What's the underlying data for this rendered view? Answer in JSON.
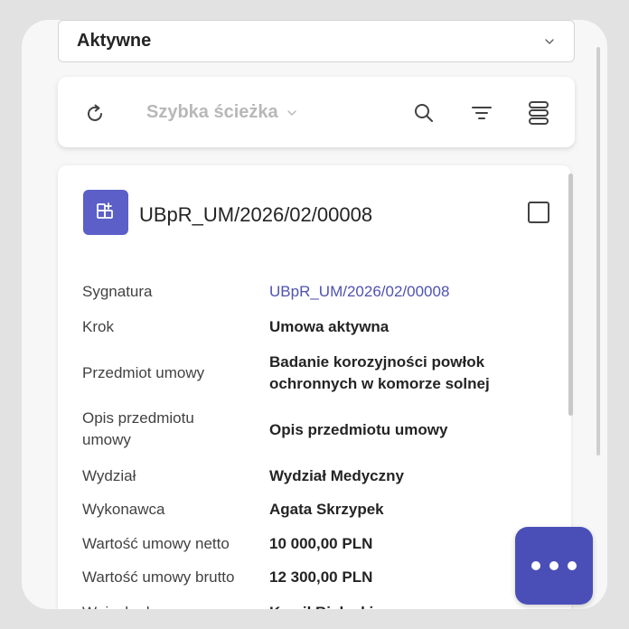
{
  "status_filter": {
    "value": "Aktywne"
  },
  "toolbar": {
    "quick_path_label": "Szybka ścieżka"
  },
  "card": {
    "title": "UBpR_UM/2026/02/00008",
    "fields": [
      {
        "label": "Sygnatura",
        "value": "UBpR_UM/2026/02/00008"
      },
      {
        "label": "Krok",
        "value": "Umowa aktywna"
      },
      {
        "label": "Przedmiot umowy",
        "value": "Badanie korozyjności powłok ochronnych w komorze solnej"
      },
      {
        "label": "Opis przedmiotu umowy",
        "value": "Opis przedmiotu umowy"
      },
      {
        "label": "Wydział",
        "value": "Wydział Medyczny"
      },
      {
        "label": "Wykonawca",
        "value": "Agata Skrzypek"
      },
      {
        "label": "Wartość umowy netto",
        "value": "10 000,00 PLN"
      },
      {
        "label": "Wartość umowy brutto",
        "value": "12 300,00 PLN"
      },
      {
        "label": "Wnioskodawca",
        "value": "Kamil Bielecki"
      }
    ]
  },
  "colors": {
    "accent": "#5b5fc7",
    "link": "#4f52b2",
    "fab": "#4a4fb8"
  }
}
